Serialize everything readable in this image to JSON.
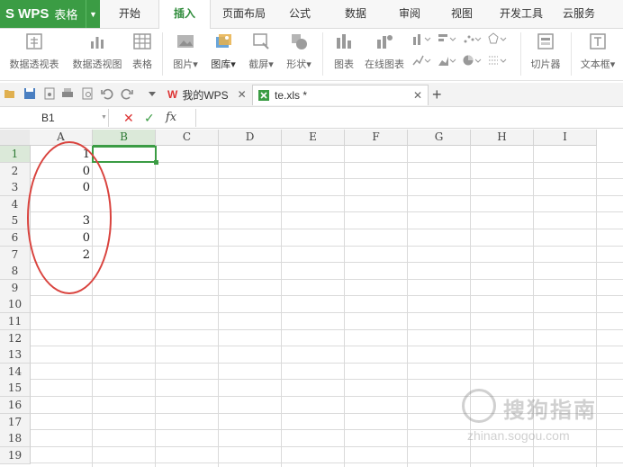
{
  "app": {
    "logo": "S WPS",
    "title": "表格"
  },
  "menu": {
    "tabs": [
      "开始",
      "插入",
      "页面布局",
      "公式",
      "数据",
      "审阅",
      "视图",
      "开发工具",
      "云服务"
    ],
    "active": "插入"
  },
  "ribbon": {
    "buttons": [
      {
        "label": "数据透视表",
        "icon": "pivot-table-icon"
      },
      {
        "label": "数据透视图",
        "icon": "pivot-chart-icon"
      },
      {
        "label": "表格",
        "icon": "table-icon"
      },
      {
        "label": "图片▾",
        "icon": "picture-icon"
      },
      {
        "label": "图库▾",
        "icon": "gallery-icon"
      },
      {
        "label": "截屏▾",
        "icon": "screenshot-icon"
      },
      {
        "label": "形状▾",
        "icon": "shapes-icon"
      },
      {
        "label": "图表",
        "icon": "chart-icon"
      },
      {
        "label": "在线图表",
        "icon": "online-chart-icon"
      },
      {
        "label": "切片器",
        "icon": "slicer-icon"
      },
      {
        "label": "文本框▾",
        "icon": "textbox-icon"
      }
    ]
  },
  "doc_tabs": {
    "home": "我的WPS",
    "file": "te.xls *",
    "new_tab_glyph": "+"
  },
  "formula_bar": {
    "name_box": "B1",
    "cancel_glyph": "✕",
    "confirm_glyph": "✓",
    "fx_glyph": "fx",
    "content": ""
  },
  "sheet": {
    "columns": [
      "A",
      "B",
      "C",
      "D",
      "E",
      "F",
      "G",
      "H",
      "I"
    ],
    "rows": [
      "1",
      "2",
      "3",
      "4",
      "5",
      "6",
      "7",
      "8",
      "9",
      "10",
      "11",
      "12",
      "13",
      "14",
      "15",
      "16",
      "17",
      "18",
      "19"
    ],
    "column_a_values": [
      "1",
      "0",
      "0",
      "",
      "3",
      "0",
      "2"
    ],
    "selected_cell": "B1"
  },
  "watermark": {
    "text": "搜狗指南",
    "url": "zhinan.sogou.com"
  },
  "colors": {
    "brand_green": "#3b9c44",
    "annotation_red": "#d9433e"
  }
}
